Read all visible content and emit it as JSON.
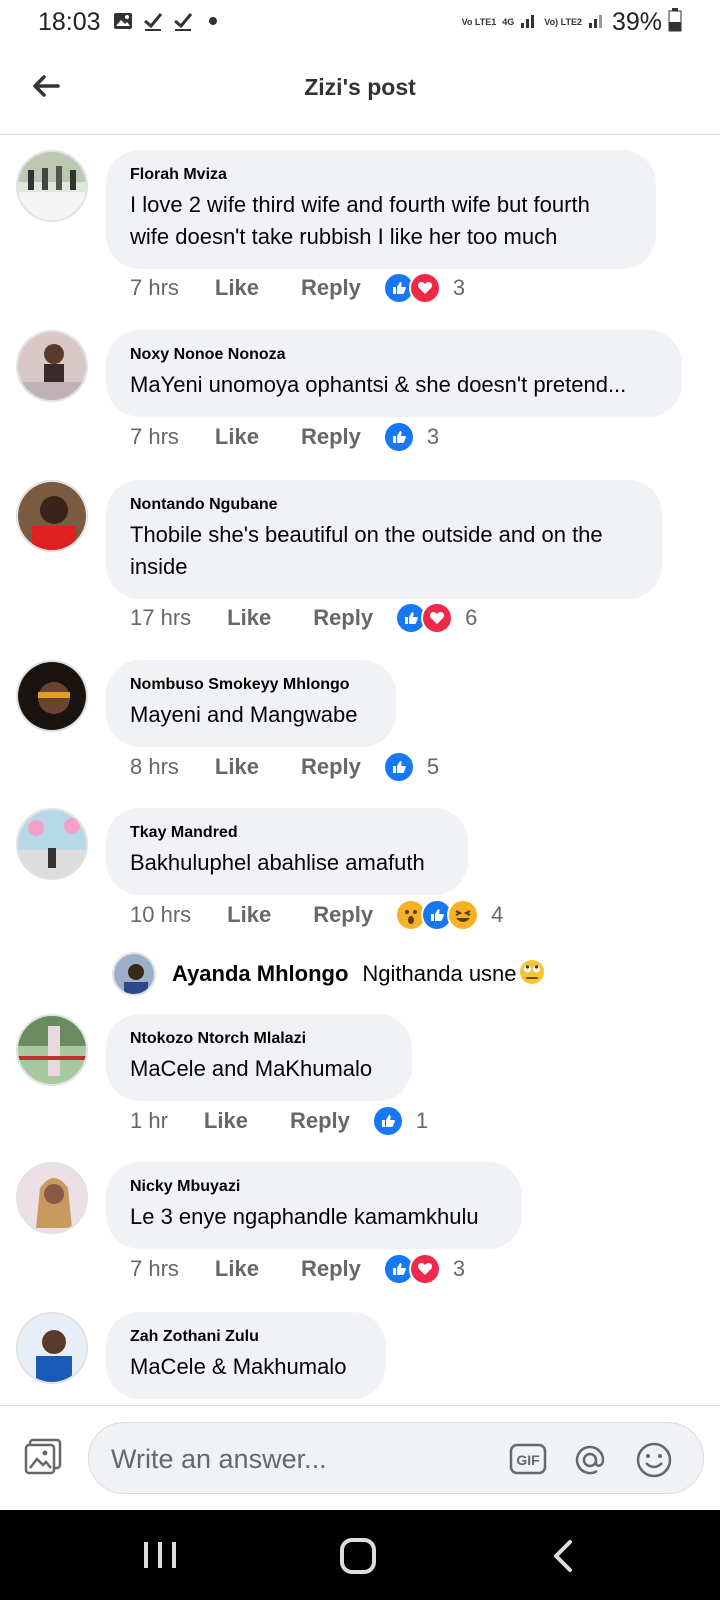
{
  "status_bar": {
    "time": "18:03",
    "battery": "39%",
    "icons": [
      "gallery-icon",
      "check-icon",
      "check-icon",
      "dot-icon"
    ],
    "net1": "Vo LTE1",
    "net1_type": "4G",
    "net2": "Vo) LTE2"
  },
  "header": {
    "title": "Zizi's post"
  },
  "comments": [
    {
      "name": "Florah Mviza",
      "text": "I love 2 wife third wife and fourth wife but fourth wife doesn't take rubbish I like her too much",
      "time": "7 hrs",
      "like": "Like",
      "reply": "Reply",
      "reactions": [
        "like",
        "love"
      ],
      "count": "3"
    },
    {
      "name": "Noxy Nonoe Nonoza",
      "text": "MaYeni unomoya ophantsi & she doesn't pretend...",
      "time": "7 hrs",
      "like": "Like",
      "reply": "Reply",
      "reactions": [
        "like"
      ],
      "count": "3"
    },
    {
      "name": "Nontando Ngubane",
      "text": "Thobile she's beautiful on the outside and on the inside",
      "time": "17 hrs",
      "like": "Like",
      "reply": "Reply",
      "reactions": [
        "like",
        "love"
      ],
      "count": "6"
    },
    {
      "name": "Nombuso Smokeyy Mhlongo",
      "text": "Mayeni and Mangwabe",
      "time": "8 hrs",
      "like": "Like",
      "reply": "Reply",
      "reactions": [
        "like"
      ],
      "count": "5"
    },
    {
      "name": "Tkay Mandred",
      "text": "Bakhuluphel abahlise amafuth",
      "time": "10 hrs",
      "like": "Like",
      "reply": "Reply",
      "reactions": [
        "wow",
        "like",
        "haha"
      ],
      "count": "4",
      "reply_preview": {
        "name": "Ayanda Mhlongo",
        "text": "Ngithanda usne"
      }
    },
    {
      "name": "Ntokozo Ntorch Mlalazi",
      "text": "MaCele and MaKhumalo",
      "time": "1 hr",
      "like": "Like",
      "reply": "Reply",
      "reactions": [
        "like"
      ],
      "count": "1"
    },
    {
      "name": "Nicky Mbuyazi",
      "text": "Le 3 enye ngaphandle kamamkhulu",
      "time": "7 hrs",
      "like": "Like",
      "reply": "Reply",
      "reactions": [
        "like",
        "love"
      ],
      "count": "3"
    },
    {
      "name": "Zah Zothani Zulu",
      "text": "MaCele & Makhumalo"
    }
  ],
  "composer": {
    "placeholder": "Write an answer..."
  },
  "colors": {
    "like": "#1877f2",
    "love": "#f02849",
    "bubble": "#f0f2f5",
    "meta": "#65676b"
  }
}
